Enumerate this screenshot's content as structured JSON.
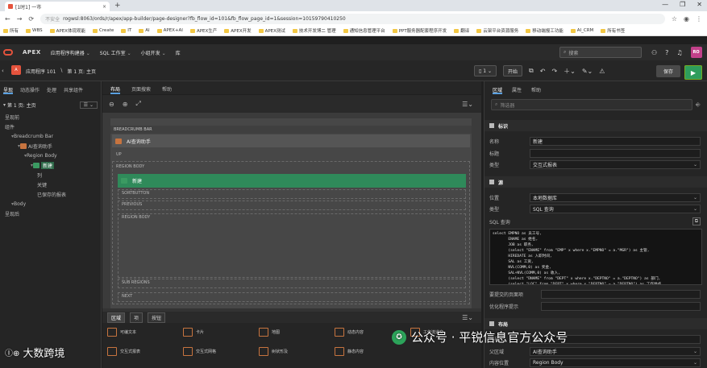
{
  "browser": {
    "tab_title": "[1时1] 一市",
    "tab_close": "×",
    "new_tab": "+",
    "window_controls": [
      "—",
      "❐",
      "✕"
    ],
    "nav": [
      "←",
      "→",
      "⟳"
    ],
    "security": "不安全",
    "url": "rogwsl:8063/ords/r/apex/app-builder/page-designer?fb_flow_id=101&fb_flow_page_id=1&session=10159790410250",
    "bookmarks": [
      "所有",
      "WBS",
      "APEX体现观能",
      "Create",
      "IT",
      "AI",
      "APEX+AI",
      "APEX生产",
      "APEX开发",
      "APEX测试",
      "技术开发博二 管理",
      "通知信息管理平台",
      "PPT服务器配套程序开发",
      "翻译",
      "云架平台资源服务",
      "移动端报工功能",
      "AI_CRM",
      "所有书签"
    ]
  },
  "apex_bar": {
    "brand": "APEX",
    "menus": [
      "应用程序构建器",
      "SQL 工作室",
      "小组开发",
      "库"
    ],
    "search_placeholder": "搜索",
    "avatar": "RO",
    "icons": [
      "user-icon",
      "help-icon",
      "bell-icon"
    ]
  },
  "page_bar": {
    "app_badge": "A",
    "crumbs": [
      "应用程序 101",
      "第 1 页: 主页"
    ],
    "page_selector": "1",
    "lock_label": "开始",
    "save": "保存",
    "run": "▶"
  },
  "left_panel": {
    "tabs": [
      "呈现",
      "动态操作",
      "处理",
      "共享组件"
    ],
    "header": "第 1 页: 主页",
    "tree": [
      {
        "label": "呈现前",
        "indent": 0,
        "icon": "none",
        "selected": false
      },
      {
        "label": "组件",
        "indent": 0,
        "icon": "none",
        "selected": false
      },
      {
        "label": "Breadcrumb Bar",
        "indent": 1,
        "icon": "none",
        "selected": false
      },
      {
        "label": "AI查询助手",
        "indent": 2,
        "icon": "orange",
        "selected": false
      },
      {
        "label": "Region Body",
        "indent": 3,
        "icon": "none",
        "selected": false
      },
      {
        "label": "新建",
        "indent": 4,
        "icon": "green",
        "selected": true
      },
      {
        "label": "列",
        "indent": 5,
        "icon": "none",
        "selected": false
      },
      {
        "label": "关键",
        "indent": 5,
        "icon": "none",
        "selected": false
      },
      {
        "label": "已保存的报表",
        "indent": 5,
        "icon": "none",
        "selected": false
      },
      {
        "label": "Body",
        "indent": 1,
        "icon": "none",
        "selected": false
      },
      {
        "label": "呈现后",
        "indent": 0,
        "icon": "none",
        "selected": false
      }
    ]
  },
  "center": {
    "tabs": [
      "布局",
      "页面搜索",
      "帮助"
    ],
    "breadcrumb_bar": "BREADCRUMB BAR",
    "region_title": "AI查询助手",
    "slots": [
      "UP",
      "REGION BODY"
    ],
    "green_region": "新建",
    "inner_slots": [
      "SORTBUTTON",
      "PREVIOUS",
      "REGION BODY",
      "SUB REGIONS",
      "NEXT"
    ]
  },
  "gallery": {
    "tabs": [
      "区域",
      "项",
      "按钮"
    ],
    "items": [
      "可编文本",
      "卡片",
      "地图",
      "动态内容",
      "工作流递交",
      "交互式报表",
      "交互式网格",
      "树状形及",
      "静态内容"
    ]
  },
  "right_panel": {
    "tabs": [
      "区域",
      "属性",
      "帮助"
    ],
    "filter_placeholder": "筛选器",
    "sections": {
      "identification": "标识",
      "source": "源",
      "layout": "布局"
    },
    "props": {
      "name_label": "名称",
      "name_value": "新建",
      "title_label": "标题",
      "title_value": "",
      "type_label": "类型",
      "type_value": "交互式报表",
      "location_label": "位置",
      "location_value": "本地数据库",
      "src_type_label": "类型",
      "src_type_value": "SQL 查询",
      "sql_label": "SQL 查询",
      "page_items_label": "要提交的页面项",
      "optimizer_label": "优化程序提示",
      "seq_label": "序号",
      "seq_value": "10",
      "parent_label": "父区域",
      "parent_value": "AI查询助手",
      "position_label": "内容位置",
      "position_value": "Region Body"
    },
    "sql": "select EMPNO as 员工号,\n       ENAME as 姓名,\n       JOB as 职务,\n       (select \"ENAME\" from \"EMP\" x where x.\"EMPNO\" = a.\"MGR\") as 主管,\n       HIREDATE as 入职时间,\n       SAL as 工资,\n       NVL(COMM,0) as 奖金,\n       SAL+NVL(COMM,0) as 收入,\n       (select \"DNAME\" from \"DEPT\" x where x.\"DEPTNO\" = a.\"DEPTNO\") as 部门,\n       (select \"LOC\" from \"DEPT\" x where x.\"DEPTNO\" = a.\"DEPTNO\") as 工作地点\nfrom \"EMP\" a"
  },
  "watermarks": {
    "wechat": "公众号 · 平锐信息官方公众号",
    "logo_text": "大数跨境",
    "logo_mark": "Ⓘ⊕"
  }
}
